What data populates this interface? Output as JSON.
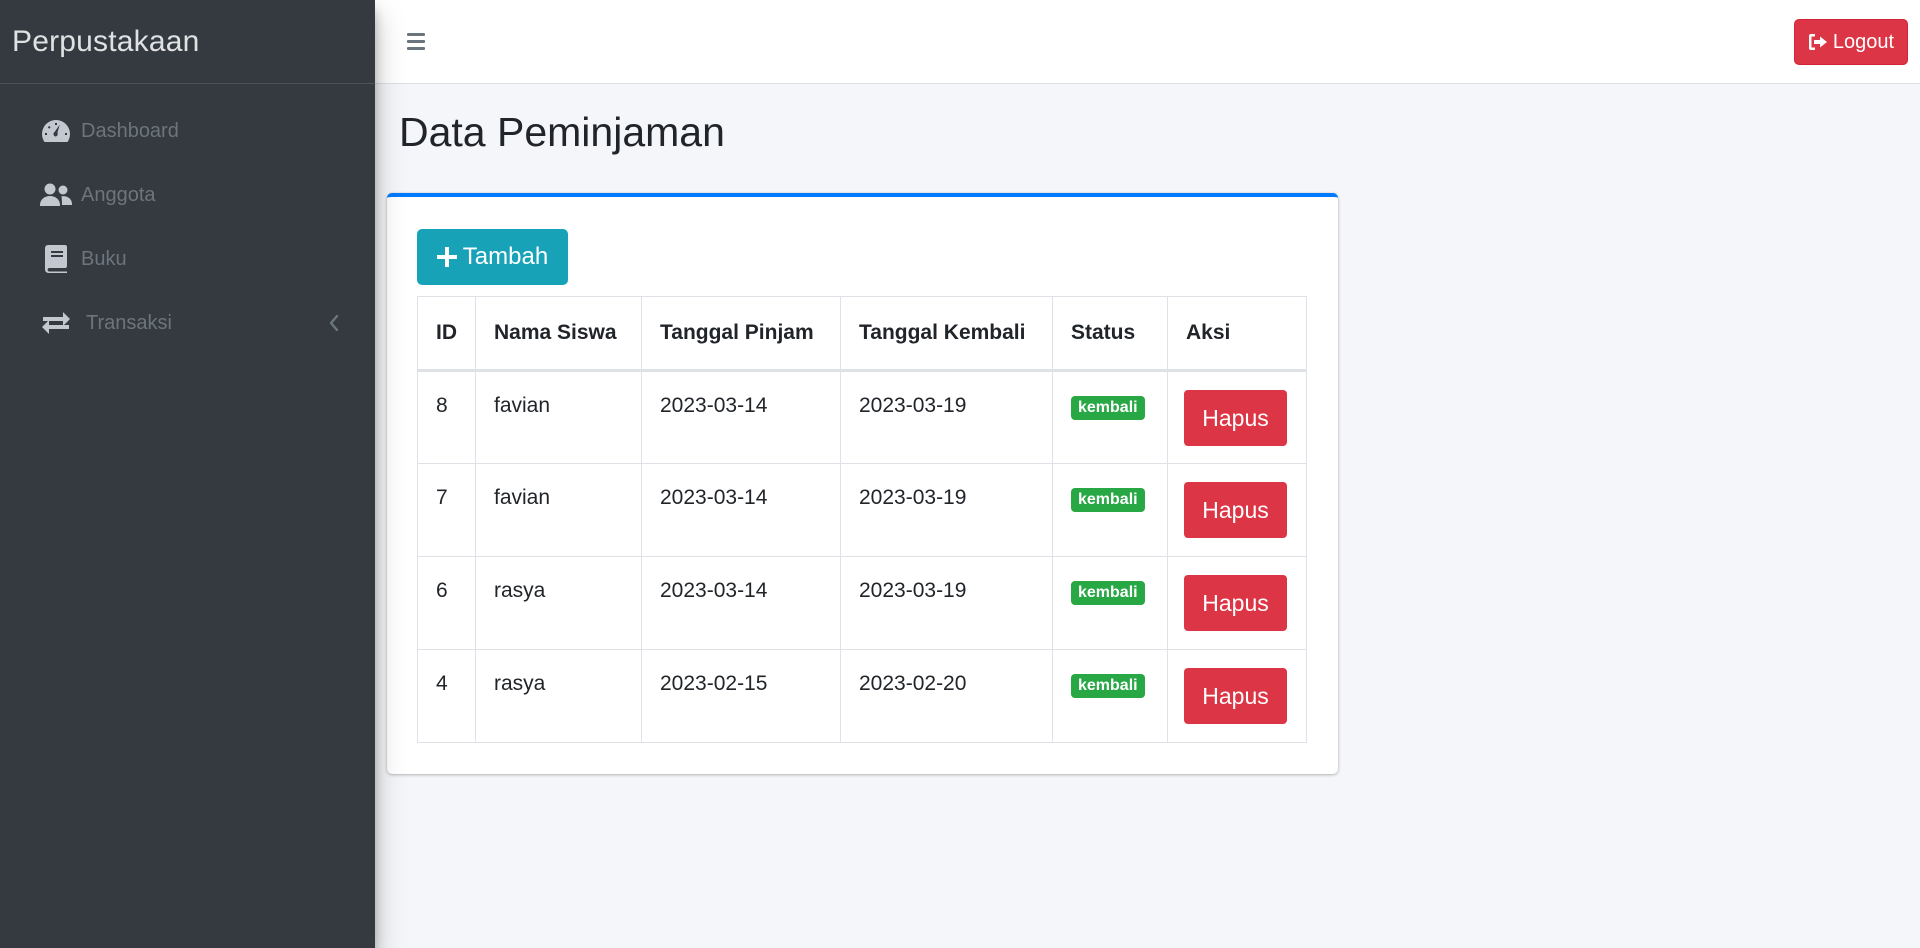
{
  "sidebar": {
    "brand": "Perpustakaan",
    "items": [
      {
        "label": "Dashboard",
        "icon": "tachometer-icon"
      },
      {
        "label": "Anggota",
        "icon": "users-icon"
      },
      {
        "label": "Buku",
        "icon": "book-icon"
      },
      {
        "label": "Transaksi",
        "icon": "exchange-icon"
      }
    ]
  },
  "topbar": {
    "menu_icon": "hamburger-icon",
    "logout_label": "Logout",
    "logout_icon": "sign-out-icon"
  },
  "main": {
    "title": "Data Peminjaman",
    "add_button_label": "Tambah",
    "table": {
      "headers": [
        "ID",
        "Nama Siswa",
        "Tanggal Pinjam",
        "Tanggal Kembali",
        "Status",
        "Aksi"
      ],
      "rows": [
        {
          "id": "8",
          "nama": "favian",
          "pinjam": "2023-03-14",
          "kembali": "2023-03-19",
          "status": "kembali",
          "action": "Hapus"
        },
        {
          "id": "7",
          "nama": "favian",
          "pinjam": "2023-03-14",
          "kembali": "2023-03-19",
          "status": "kembali",
          "action": "Hapus"
        },
        {
          "id": "6",
          "nama": "rasya",
          "pinjam": "2023-03-14",
          "kembali": "2023-03-19",
          "status": "kembali",
          "action": "Hapus"
        },
        {
          "id": "4",
          "nama": "rasya",
          "pinjam": "2023-02-15",
          "kembali": "2023-02-20",
          "status": "kembali",
          "action": "Hapus"
        }
      ]
    }
  },
  "colors": {
    "sidebar_bg": "#343a40",
    "accent": "#007bff",
    "info": "#17a2b8",
    "danger": "#dc3545",
    "success": "#28a745"
  }
}
